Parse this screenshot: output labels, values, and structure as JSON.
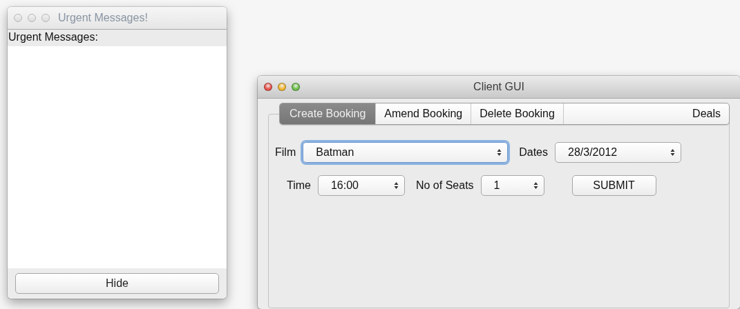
{
  "urgent_window": {
    "title": "Urgent Messages!",
    "active": false,
    "heading": "Urgent Messages:",
    "hide_button": "Hide"
  },
  "client_window": {
    "title": "Client GUI",
    "active": true,
    "tabs": [
      {
        "label": "Create Booking",
        "selected": true
      },
      {
        "label": "Amend Booking",
        "selected": false
      },
      {
        "label": "Delete Booking",
        "selected": false
      },
      {
        "label": "Deals",
        "selected": false
      }
    ],
    "form_rows": [
      [
        {
          "kind": "label",
          "text": "Film"
        },
        {
          "kind": "popup",
          "value": "Batman",
          "focused": true
        },
        {
          "kind": "label",
          "text": "Dates"
        },
        {
          "kind": "popup",
          "value": "28/3/2012",
          "focused": false
        }
      ],
      [
        {
          "kind": "label",
          "text": "Time"
        },
        {
          "kind": "popup",
          "value": "16:00",
          "focused": false
        },
        {
          "kind": "label",
          "text": "No of Seats"
        },
        {
          "kind": "popup",
          "value": "1",
          "focused": false
        },
        {
          "kind": "button",
          "text": "SUBMIT"
        }
      ]
    ]
  }
}
